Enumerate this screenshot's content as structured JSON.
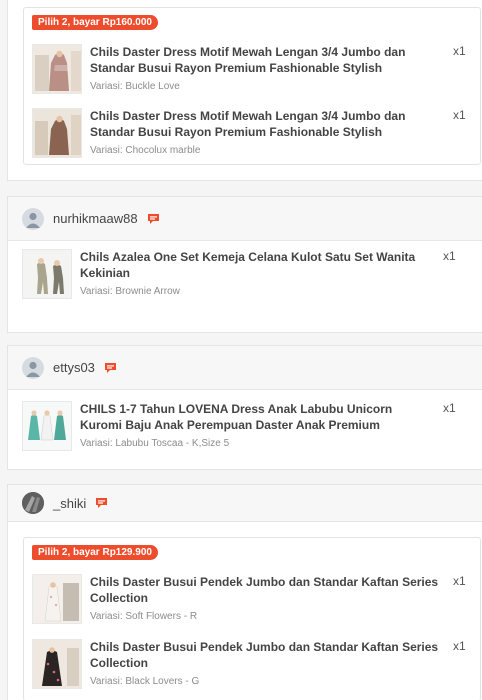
{
  "colors": {
    "accent": "#ee4d2d",
    "text": "#444444",
    "muted": "#8c8c8c"
  },
  "group1": {
    "promo": "Pilih 2, bayar Rp160.000",
    "items": [
      {
        "title": "Chils Daster Dress Motif Mewah Lengan 3/4 Jumbo dan Standar Busui Rayon Premium Fashionable Stylish",
        "variant": "Variasi: Buckle Love",
        "qty": "x1"
      },
      {
        "title": "Chils Daster Dress Motif Mewah Lengan 3/4 Jumbo dan Standar Busui Rayon Premium Fashionable Stylish",
        "variant": "Variasi: Chocolux marble",
        "qty": "x1"
      }
    ]
  },
  "orders": [
    {
      "seller": "nurhikmaaw88",
      "chat_icon": "chat-icon",
      "items": [
        {
          "title": "Chils Azalea One Set Kemeja Celana Kulot Satu Set Wanita Kekinian",
          "variant": "Variasi: Brownie Arrow",
          "qty": "x1"
        }
      ]
    },
    {
      "seller": "ettys03",
      "chat_icon": "chat-icon",
      "items": [
        {
          "title": "CHILS 1-7 Tahun LOVENA Dress Anak Labubu Unicorn Kuromi Baju Anak Perempuan Daster Anak Premium",
          "variant": "Variasi: Labubu Toscaa - K,Size 5",
          "qty": "x1"
        }
      ]
    },
    {
      "seller": "_shiki",
      "chat_icon": "chat-icon",
      "promo": "Pilih 2, bayar Rp129.900",
      "items": [
        {
          "title": "Chils Daster Busui Pendek Jumbo dan Standar Kaftan Series Collection",
          "variant": "Variasi: Soft Flowers - R",
          "qty": "x1"
        },
        {
          "title": "Chils Daster Busui Pendek Jumbo dan Standar Kaftan Series Collection",
          "variant": "Variasi: Black Lovers - G",
          "qty": "x1"
        }
      ]
    }
  ]
}
